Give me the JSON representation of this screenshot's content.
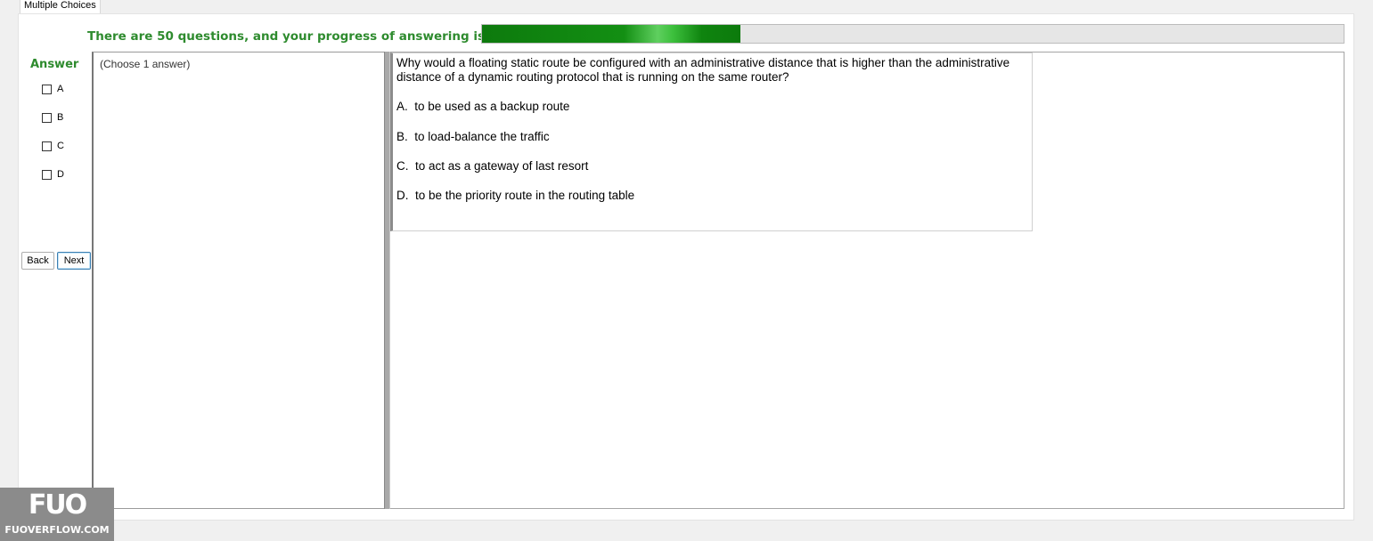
{
  "tab": {
    "label": "Multiple Choices"
  },
  "progress": {
    "label": "There are 50 questions, and your progress of answering is",
    "fraction": 0.3
  },
  "answer": {
    "heading": "Answer",
    "options": [
      {
        "label": "A",
        "checked": false
      },
      {
        "label": "B",
        "checked": false
      },
      {
        "label": "C",
        "checked": false
      },
      {
        "label": "D",
        "checked": false
      }
    ]
  },
  "nav": {
    "back_label": "Back",
    "next_label": "Next"
  },
  "instruction": "(Choose 1 answer)",
  "question": {
    "text": "Why would a floating static route be configured with an administrative distance that is higher than the administrative distance of a dynamic routing protocol that is running on the same router?",
    "choices": [
      "A.  to be used as a backup route",
      "B.  to load-balance the traffic",
      "C.  to act as a gateway of last resort",
      "D.  to be the priority route in the routing table"
    ]
  },
  "watermark": {
    "logo": "FUO",
    "site": "FUOVERFLOW.COM"
  },
  "colors": {
    "accent_green": "#2e8b2e",
    "progress_green": "#138f13"
  }
}
